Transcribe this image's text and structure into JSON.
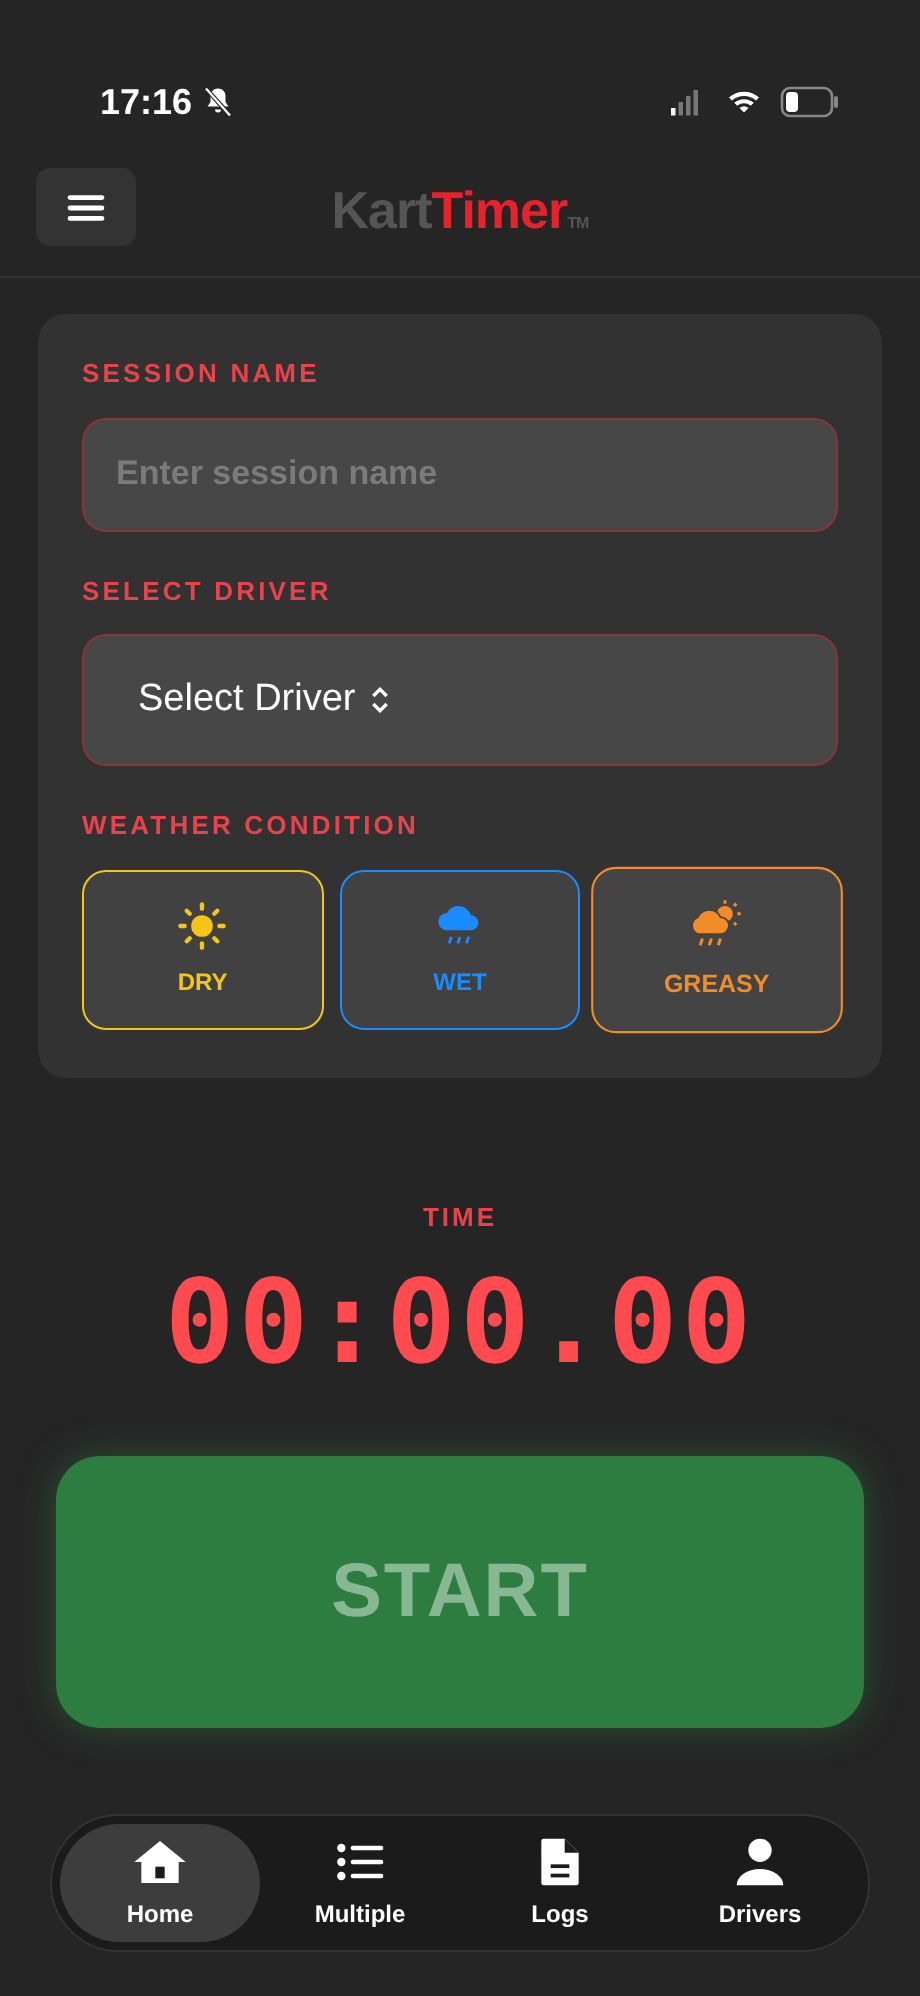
{
  "status_bar": {
    "time": "17:16"
  },
  "header": {
    "logo": {
      "part_1": "Kart",
      "part_2": "Timer",
      "mark": "TM"
    }
  },
  "form": {
    "session_label": "SESSION NAME",
    "session_field": {
      "placeholder": "Enter session name"
    },
    "driver_label": "SELECT DRIVER",
    "driver_select": {
      "value": "Select Driver"
    },
    "weather_label": "WEATHER CONDITION",
    "weather_options": [
      {
        "kind": "sun",
        "label": "DRY",
        "color": "#f5c518",
        "selected": false
      },
      {
        "kind": "rain",
        "label": "WET",
        "color": "#1a8cff",
        "selected": false
      },
      {
        "kind": "partly",
        "label": "GREASY",
        "color": "#f28c28",
        "selected": true
      }
    ]
  },
  "timer": {
    "label": "TIME",
    "value": "00:00.00"
  },
  "start_button": {
    "label": "START"
  },
  "tabs": [
    {
      "kind": "home",
      "label": "Home",
      "selected": true
    },
    {
      "kind": "list",
      "label": "Multiple",
      "selected": false
    },
    {
      "kind": "doc",
      "label": "Logs",
      "selected": false
    },
    {
      "kind": "person",
      "label": "Drivers",
      "selected": false
    }
  ]
}
